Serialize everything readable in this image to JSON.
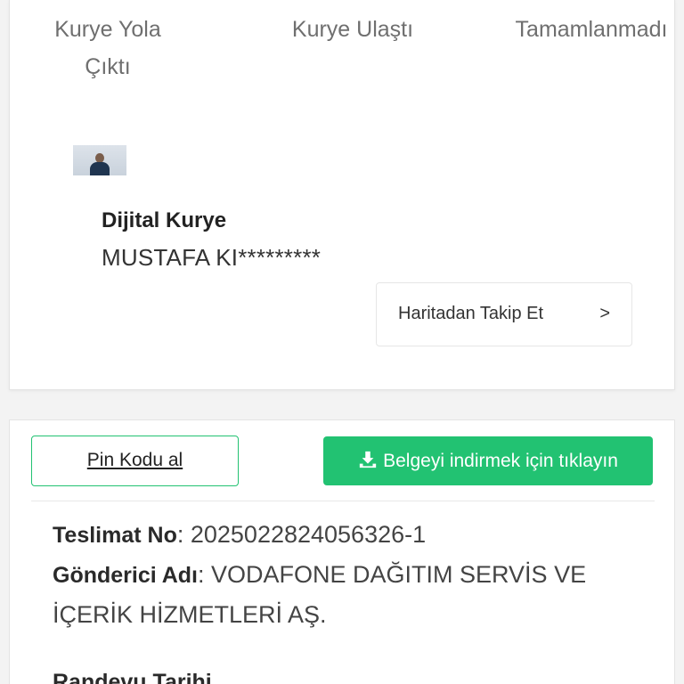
{
  "status_steps": [
    {
      "label": "Kurye Yola Çıktı"
    },
    {
      "label": "Kurye Ulaştı"
    },
    {
      "label": "Tamamlanmadı"
    }
  ],
  "courier": {
    "title": "Dijital Kurye",
    "name": "MUSTAFA KI*********",
    "track_label": "Haritadan Takip Et",
    "track_chevron": ">"
  },
  "actions": {
    "pin_label": "Pin Kodu al",
    "download_label": "Belgeyi indirmek için tıklayın",
    "download_icon": "download-icon",
    "accent_color": "#22c272"
  },
  "details": {
    "delivery_no_label": "Teslimat No",
    "delivery_no_value": "2025022824056326-1",
    "sender_label": "Gönderici Adı",
    "sender_value_line1": "VODAFONE DAĞITIM SERVİS VE",
    "sender_value_line2": "İÇERİK HİZMETLERİ AŞ.",
    "appointment_label": "Randevu Tarihi"
  }
}
